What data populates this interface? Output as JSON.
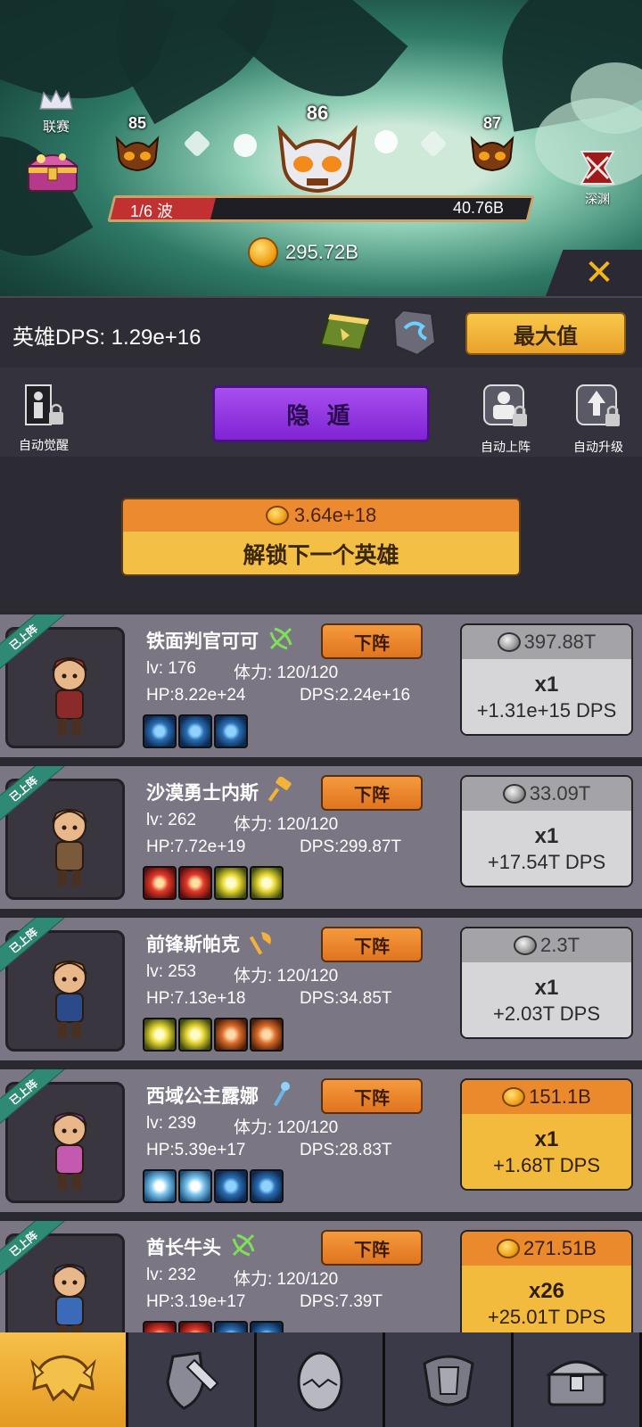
{
  "header": {
    "league_label": "联赛",
    "abyss_label": "深渊",
    "stages": {
      "prev": "85",
      "current": "86",
      "next": "87"
    },
    "wave": {
      "label": "1/6 波",
      "progress": 0.24,
      "hp": "40.76B"
    },
    "gold": "295.72B"
  },
  "dps_bar": {
    "dps_text": "英雄DPS: 1.29e+16",
    "max_label": "最大值"
  },
  "auto_row": {
    "auto_awaken": "自动觉醒",
    "hide_label": "隐 遁",
    "auto_deploy": "自动上阵",
    "auto_upgrade": "自动升级"
  },
  "unlock": {
    "cost": "3.64e+18",
    "label": "解锁下一个英雄"
  },
  "heroes": [
    {
      "badge": "已上阵",
      "name": "铁面判官可可",
      "class_icon": "crossbow-icon",
      "retire_label": "下阵",
      "lv": "lv: 176",
      "stamina": "体力: 120/120",
      "hp": "HP:8.22e+24",
      "dps": "DPS:2.24e+16",
      "skills": [
        "blue",
        "blue",
        "blue"
      ],
      "upgrade": {
        "style": "grey",
        "cost": "397.88T",
        "mult": "x1",
        "gain": "+1.31e+15 DPS"
      }
    },
    {
      "badge": "已上阵",
      "name": "沙漠勇士内斯",
      "class_icon": "hammer-icon",
      "retire_label": "下阵",
      "lv": "lv: 262",
      "stamina": "体力: 120/120",
      "hp": "HP:7.72e+19",
      "dps": "DPS:299.87T",
      "skills": [
        "red",
        "red",
        "yellow",
        "yellow"
      ],
      "upgrade": {
        "style": "grey",
        "cost": "33.09T",
        "mult": "x1",
        "gain": "+17.54T DPS"
      }
    },
    {
      "badge": "已上阵",
      "name": "前锋斯帕克",
      "class_icon": "axe-icon",
      "retire_label": "下阵",
      "lv": "lv: 253",
      "stamina": "体力: 120/120",
      "hp": "HP:7.13e+18",
      "dps": "DPS:34.85T",
      "skills": [
        "yellow",
        "yellow",
        "orange",
        "orange"
      ],
      "upgrade": {
        "style": "grey",
        "cost": "2.3T",
        "mult": "x1",
        "gain": "+2.03T DPS"
      }
    },
    {
      "badge": "已上阵",
      "name": "西域公主露娜",
      "class_icon": "staff-icon",
      "retire_label": "下阵",
      "lv": "lv: 239",
      "stamina": "体力: 120/120",
      "hp": "HP:5.39e+17",
      "dps": "DPS:28.83T",
      "skills": [
        "ice",
        "ice",
        "blue",
        "blue"
      ],
      "upgrade": {
        "style": "gold",
        "cost": "151.1B",
        "mult": "x1",
        "gain": "+1.68T DPS"
      }
    },
    {
      "badge": "已上阵",
      "name": "酋长牛头",
      "class_icon": "crossbow-icon",
      "retire_label": "下阵",
      "lv": "lv: 232",
      "stamina": "体力: 120/120",
      "hp": "HP:3.19e+17",
      "dps": "DPS:7.39T",
      "skills": [
        "red",
        "red",
        "blue",
        "blue"
      ],
      "upgrade": {
        "style": "gold",
        "cost": "271.51B",
        "mult": "x26",
        "gain": "+25.01T DPS"
      }
    }
  ],
  "bottom_nav": [
    "heroes-helmet-icon",
    "equipment-shield-icon",
    "pet-egg-icon",
    "armor-icon",
    "treasure-chest-icon"
  ],
  "colors": {
    "accent_gold": "#f3bf45",
    "accent_orange": "#ec8a2f",
    "purple": "#7e24d4",
    "teal_ribbon": "#2f8a75"
  }
}
